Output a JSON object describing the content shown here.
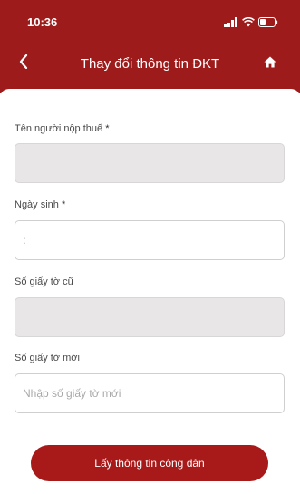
{
  "status_bar": {
    "time": "10:36"
  },
  "navbar": {
    "title": "Thay đổi thông tin ĐKT"
  },
  "form": {
    "taxpayer_name": {
      "label": "Tên người nộp thuế",
      "required_mark": "*",
      "value": ""
    },
    "birth_date": {
      "label": "Ngày sinh",
      "required_mark": "*",
      "value": ":"
    },
    "old_id": {
      "label": "Số giấy tờ cũ",
      "value": ""
    },
    "new_id": {
      "label": "Số giấy tờ mới",
      "placeholder": "Nhập số giấy tờ mới",
      "value": ""
    },
    "submit_label": "Lấy thông tin công dân"
  },
  "colors": {
    "header": "#9e1b1b",
    "button": "#a81a1a",
    "disabled_field": "#e8e6e6"
  },
  "icons": {
    "back": "chevron-left-icon",
    "home": "home-icon",
    "signal": "signal-icon",
    "wifi": "wifi-icon",
    "battery": "battery-icon"
  }
}
